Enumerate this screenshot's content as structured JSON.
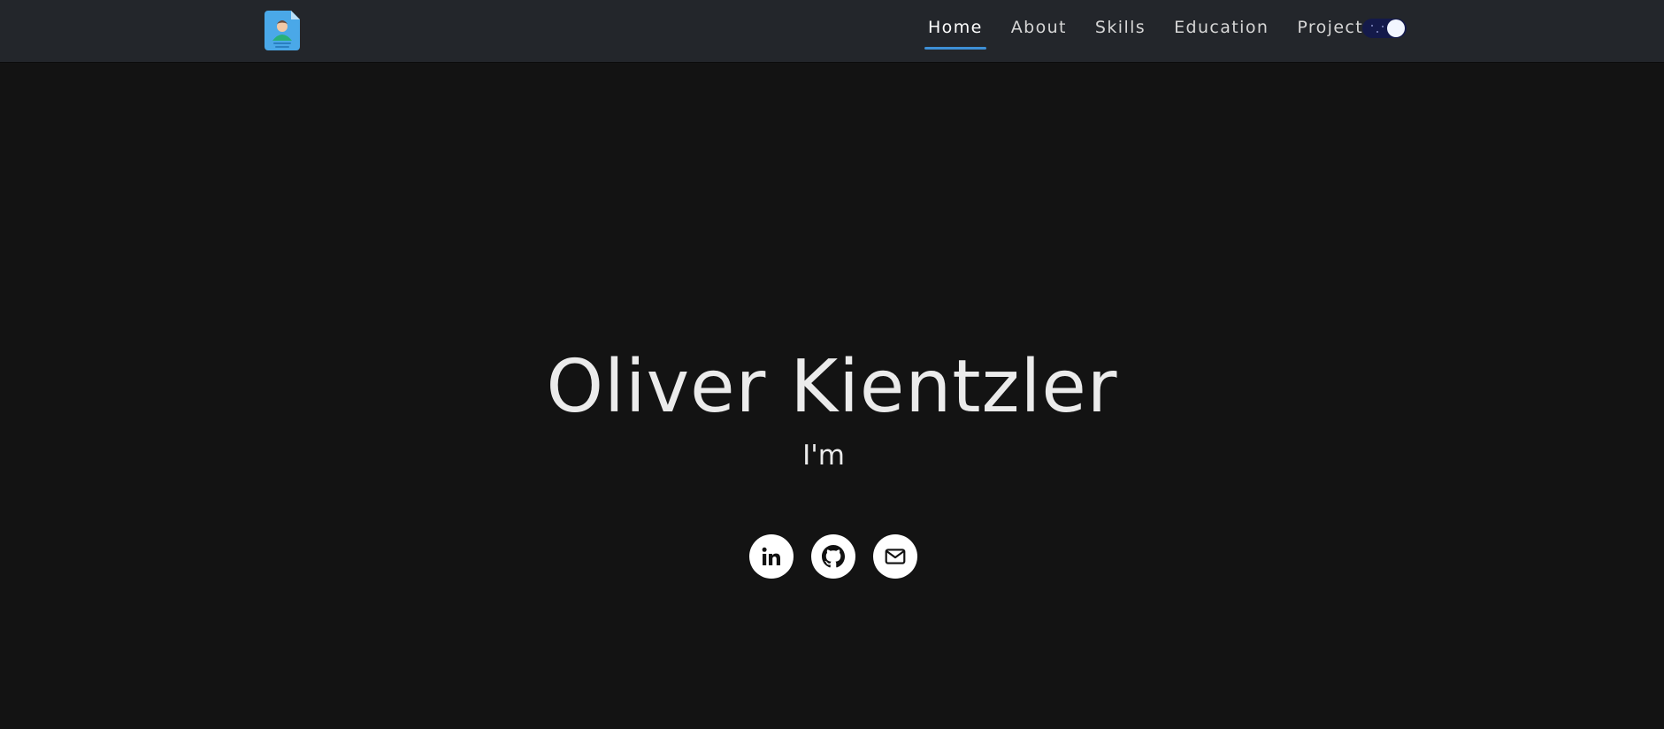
{
  "nav": {
    "links": [
      {
        "label": "Home",
        "active": true
      },
      {
        "label": "About",
        "active": false
      },
      {
        "label": "Skills",
        "active": false
      },
      {
        "label": "Education",
        "active": false
      },
      {
        "label": "Projects",
        "active": false
      }
    ],
    "theme_toggle": "dark-mode",
    "logo_icon": "resume-icon"
  },
  "hero": {
    "name": "Oliver Kientzler",
    "subtitle": "I'm"
  },
  "socials": [
    {
      "icon": "linkedin-icon"
    },
    {
      "icon": "github-icon"
    },
    {
      "icon": "email-icon"
    }
  ],
  "colors": {
    "background": "#131313",
    "navbar": "#23262b",
    "accent": "#3d8fd6",
    "text": "#ebebeb",
    "toggle": "#141a4a"
  }
}
